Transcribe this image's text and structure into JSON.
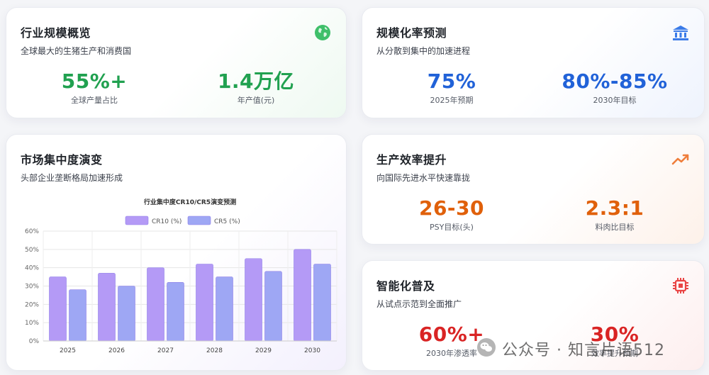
{
  "cards": {
    "industry_scale": {
      "title": "行业规模概览",
      "subtitle": "全球最大的生猪生产和消费国",
      "icon": "globe-icon",
      "stats": [
        {
          "value": "55%+",
          "label": "全球产量占比"
        },
        {
          "value": "1.4万亿",
          "label": "年产值(元)"
        }
      ]
    },
    "scale_rate": {
      "title": "规模化率预测",
      "subtitle": "从分散到集中的加速进程",
      "icon": "bank-icon",
      "stats": [
        {
          "value": "75%",
          "label": "2025年预期"
        },
        {
          "value": "80%-85%",
          "label": "2030年目标"
        }
      ]
    },
    "market_concentration": {
      "title": "市场集中度演变",
      "subtitle": "头部企业垄断格局加速形成"
    },
    "efficiency": {
      "title": "生产效率提升",
      "subtitle": "向国际先进水平快速靠拢",
      "icon": "trending-up-icon",
      "stats": [
        {
          "value": "26-30",
          "label": "PSY目标(头)"
        },
        {
          "value": "2.3:1",
          "label": "料肉比目标"
        }
      ]
    },
    "intelligence": {
      "title": "智能化普及",
      "subtitle": "从试点示范到全面推广",
      "icon": "chip-icon",
      "stats": [
        {
          "value": "60%+",
          "label": "2030年渗透率"
        },
        {
          "value": "30%",
          "label": "效率提升预期"
        }
      ]
    }
  },
  "chart_data": {
    "type": "bar",
    "title": "行业集中度CR10/CR5演变预测",
    "categories": [
      "2025",
      "2026",
      "2027",
      "2028",
      "2029",
      "2030"
    ],
    "series": [
      {
        "name": "CR10 (%)",
        "values": [
          35,
          37,
          40,
          42,
          45,
          50
        ],
        "color": "#b49af6"
      },
      {
        "name": "CR5 (%)",
        "values": [
          28,
          30,
          32,
          35,
          38,
          42
        ],
        "color": "#9ea7f4"
      }
    ],
    "ylim": [
      0,
      60
    ],
    "yticks": [
      "0%",
      "10%",
      "20%",
      "30%",
      "40%",
      "50%",
      "60%"
    ],
    "legend": "top",
    "grid": true
  },
  "watermark": {
    "text": "公众号 · 知言片语512"
  },
  "colors": {
    "green": "#21a150",
    "blue": "#2162d8",
    "orange": "#e0600a",
    "red": "#d92424"
  }
}
